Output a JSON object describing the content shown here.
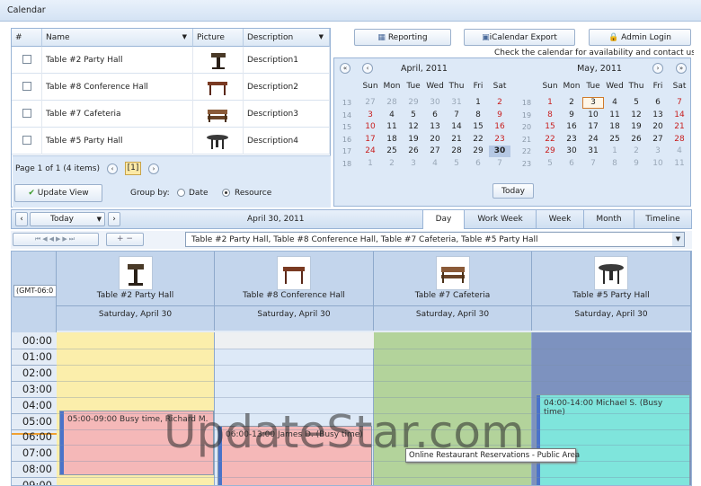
{
  "window": {
    "title": "Calendar"
  },
  "grid": {
    "columns": [
      "#",
      "Name",
      "Picture",
      "Description"
    ],
    "rows": [
      {
        "name": "Table #2 Party Hall",
        "desc": "Description1"
      },
      {
        "name": "Table #8 Conference Hall",
        "desc": "Description2"
      },
      {
        "name": "Table #7 Cafeteria",
        "desc": "Description3"
      },
      {
        "name": "Table #5 Party Hall",
        "desc": "Description4"
      }
    ],
    "pager_text": "Page 1 of 1 (4 items)",
    "current_page": "[1]",
    "update_label": "Update View",
    "groupby_label": "Group by:",
    "groupby_date": "Date",
    "groupby_resource": "Resource",
    "groupby_selected": "Resource"
  },
  "topbuttons": {
    "reporting": "Reporting",
    "ical": "iCalendar Export",
    "admin": "Admin Login",
    "notice": "Check the calendar for availability and contact us"
  },
  "calendar": {
    "weekdays": [
      "Sun",
      "Mon",
      "Tue",
      "Wed",
      "Thu",
      "Fri",
      "Sat"
    ],
    "today_label": "Today",
    "months": [
      {
        "title": "April, 2011",
        "weeks": [
          "13",
          "14",
          "15",
          "16",
          "17",
          "18"
        ],
        "days": [
          "27",
          "28",
          "29",
          "30",
          "31",
          "1",
          "2",
          "3",
          "4",
          "5",
          "6",
          "7",
          "8",
          "9",
          "10",
          "11",
          "12",
          "13",
          "14",
          "15",
          "16",
          "17",
          "18",
          "19",
          "20",
          "21",
          "22",
          "23",
          "24",
          "25",
          "26",
          "27",
          "28",
          "29",
          "30",
          "1",
          "2",
          "3",
          "4",
          "5",
          "6",
          "7"
        ]
      },
      {
        "title": "May, 2011",
        "weeks": [
          "18",
          "19",
          "20",
          "21",
          "22",
          "23"
        ],
        "days": [
          "1",
          "2",
          "3",
          "4",
          "5",
          "6",
          "7",
          "8",
          "9",
          "10",
          "11",
          "12",
          "13",
          "14",
          "15",
          "16",
          "17",
          "18",
          "19",
          "20",
          "21",
          "22",
          "23",
          "24",
          "25",
          "26",
          "27",
          "28",
          "29",
          "30",
          "31",
          "1",
          "2",
          "3",
          "4",
          "5",
          "6",
          "7",
          "8",
          "9",
          "10",
          "11"
        ]
      }
    ]
  },
  "toolbar": {
    "today": "Today",
    "date": "April 30, 2011",
    "tabs": [
      "Day",
      "Work Week",
      "Week",
      "Month",
      "Timeline"
    ],
    "active_tab": "Day"
  },
  "filter": {
    "value": "Table #2 Party Hall, Table #8 Conference Hall, Table #7 Cafeteria, Table #5 Party Hall"
  },
  "schedule": {
    "tz": "(GMT-06:0",
    "resources": [
      {
        "name": "Table #2 Party Hall",
        "date": "Saturday, April 30"
      },
      {
        "name": "Table #8 Conference Hall",
        "date": "Saturday, April 30"
      },
      {
        "name": "Table #7 Cafeteria",
        "date": "Saturday, April 30"
      },
      {
        "name": "Table #5 Party Hall",
        "date": "Saturday, April 30"
      }
    ],
    "hours": [
      "00:00",
      "01:00",
      "02:00",
      "03:00",
      "04:00",
      "05:00",
      "06:00",
      "07:00",
      "08:00",
      "09:00"
    ],
    "appointments": [
      {
        "text": "05:00-09:00 Busy time, Richard M."
      },
      {
        "text": "06:00-13:00 James D. (Busy time)"
      },
      {
        "text": "04:00-14:00 Michael S. (Busy time)"
      }
    ],
    "tooltip": "Online Restaurant Reservations - Public Area"
  },
  "watermark": "UpdateStar.com",
  "colors": {
    "col1": "#fbeeab",
    "col2": "#dde9f7",
    "col3": "#b3d39b",
    "col4": "#7d92bf",
    "appt1": "#f5b8b8",
    "appt2": "#f5b8b8",
    "appt3": "#7fe5dc"
  }
}
